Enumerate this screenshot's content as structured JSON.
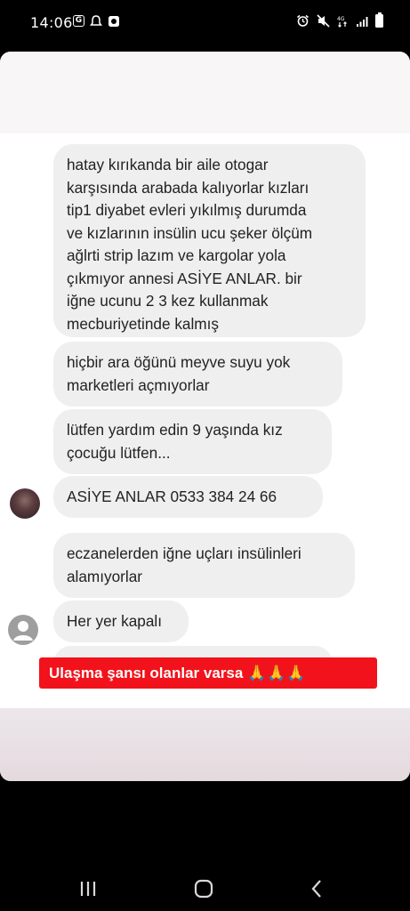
{
  "status_bar": {
    "time": "14:06",
    "left_icons": [
      "google-g-icon",
      "notification-icon",
      "whatsapp-icon"
    ],
    "right_icons": [
      "alarm-icon",
      "mute-icon",
      "data-icon",
      "signal-icon",
      "battery-icon"
    ],
    "data_label": "4G"
  },
  "messages": [
    {
      "text": "hatay kırıkanda bir aile otogar\nkarşısında arabada kalıyorlar kızları\ntip1 diyabet evleri yıkılmış durumda\nve kızlarının insülin ucu şeker ölçüm\nağlrti strip lazım ve kargolar yola\nçıkmıyor annesi ASİYE ANLAR. bir\niğne ucunu 2 3 kez kullanmak\nmecburiyetinde kalmış"
    },
    {
      "text": "hiçbir ara öğünü meyve suyu yok\nmarketleri açmıyorlar"
    },
    {
      "text": "lütfen yardım edin 9 yaşında kız\nçocuğu lütfen..."
    },
    {
      "text": "ASİYE ANLAR 0533 384 24 66"
    },
    {
      "text": "eczanelerden iğne uçları insülinleri\nalamıyorlar"
    },
    {
      "text": "Her yer kapalı"
    }
  ],
  "banner": {
    "text": "Ulaşma şansı olanlar varsa",
    "emoji": "🙏🙏🙏"
  },
  "colors": {
    "bubble_bg": "#efefef",
    "banner_bg": "#f2121b",
    "background": "#000000"
  }
}
